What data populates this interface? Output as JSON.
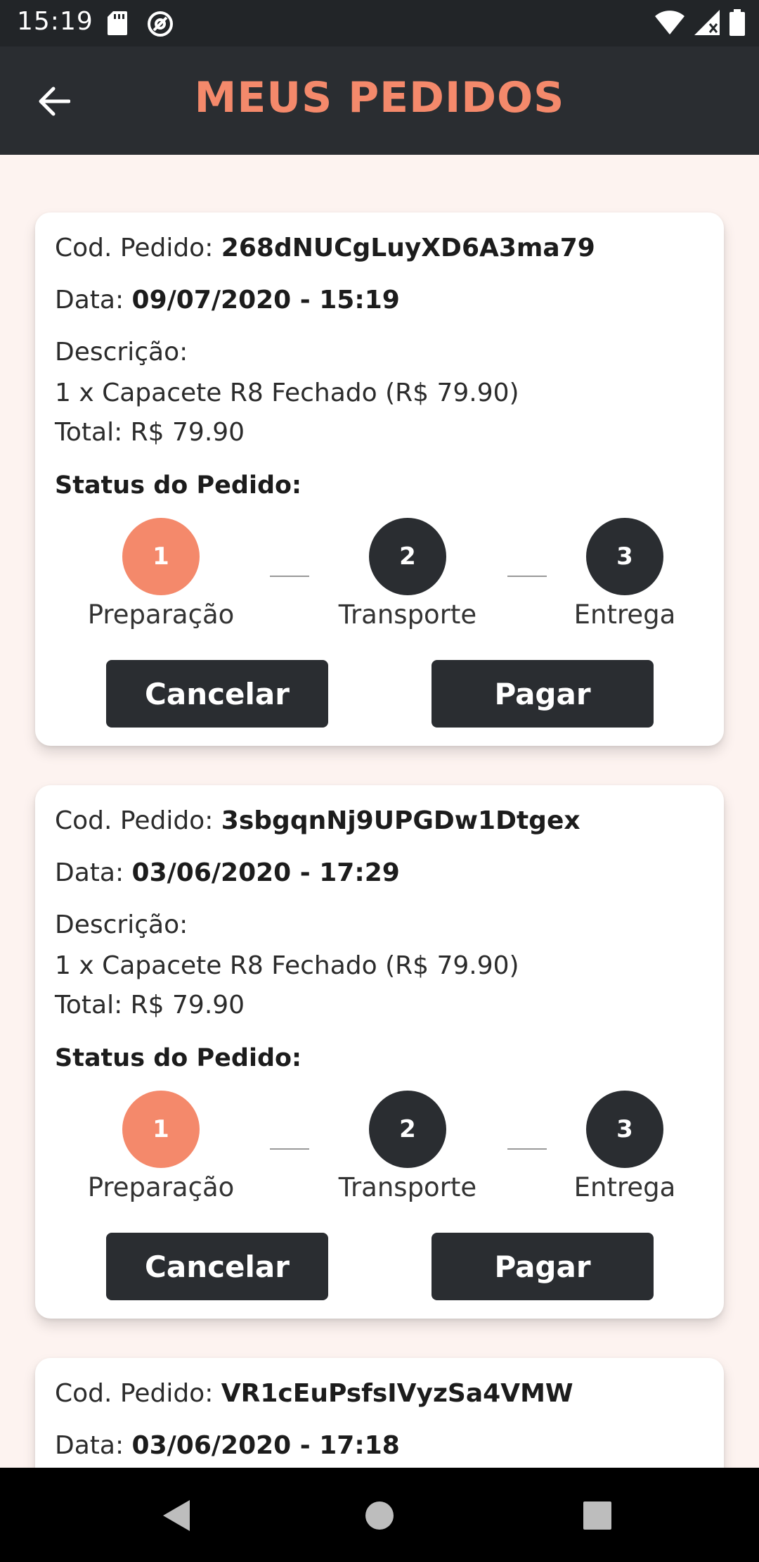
{
  "status_bar": {
    "time": "15:19",
    "icons": [
      "sd-card-icon",
      "at-sign-icon",
      "wifi-icon",
      "cellular-signal-icon",
      "battery-icon"
    ]
  },
  "app_bar": {
    "title": "MEUS PEDIDOS",
    "back_icon": "arrow-left-icon"
  },
  "labels": {
    "code": "Cod. Pedido:",
    "date": "Data:",
    "description": "Descrição:",
    "status": "Status do Pedido:"
  },
  "orders": [
    {
      "code": "268dNUCgLuyXD6A3ma79",
      "date": "09/07/2020 - 15:19",
      "item": "1 x Capacete R8 Fechado (R$ 79.90)",
      "total": "Total: R$ 79.90",
      "steps": [
        {
          "number": "1",
          "label": "Preparação",
          "active": true
        },
        {
          "number": "2",
          "label": "Transporte",
          "active": false
        },
        {
          "number": "3",
          "label": "Entrega",
          "active": false
        }
      ],
      "cancel_label": "Cancelar",
      "pay_label": "Pagar"
    },
    {
      "code": "3sbgqnNj9UPGDw1Dtgex",
      "date": "03/06/2020 - 17:29",
      "item": "1 x Capacete R8 Fechado (R$ 79.90)",
      "total": "Total: R$ 79.90",
      "steps": [
        {
          "number": "1",
          "label": "Preparação",
          "active": true
        },
        {
          "number": "2",
          "label": "Transporte",
          "active": false
        },
        {
          "number": "3",
          "label": "Entrega",
          "active": false
        }
      ],
      "cancel_label": "Cancelar",
      "pay_label": "Pagar"
    },
    {
      "code": "VR1cEuPsfsIVyzSa4VMW",
      "date": "03/06/2020 - 17:18"
    }
  ],
  "colors": {
    "accent": "#f4896b",
    "dark": "#2a2d31",
    "background": "#fdf3f0"
  },
  "nav_bar": {
    "icons": [
      "back-triangle-icon",
      "home-circle-icon",
      "recents-square-icon"
    ]
  }
}
